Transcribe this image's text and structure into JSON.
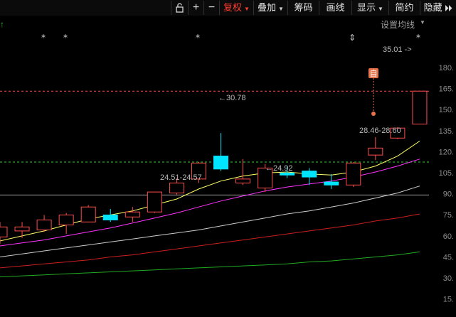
{
  "toolbar": {
    "items": [
      {
        "label": "",
        "icon": "unlock-icon"
      },
      {
        "label": "+",
        "icon": "zoom-in-icon"
      },
      {
        "label": "−",
        "icon": "zoom-out-icon"
      },
      {
        "label": "复权",
        "dropdown": true,
        "active": true
      },
      {
        "label": "叠加",
        "dropdown": true
      },
      {
        "label": "筹码"
      },
      {
        "label": "画线"
      },
      {
        "label": "显示",
        "dropdown": true
      },
      {
        "label": "简约"
      },
      {
        "label": "隐藏"
      }
    ],
    "hide_icon": "double-chevron-right-icon"
  },
  "settings_label": "设置均线",
  "corner_icon": "up-arrow-icon",
  "price_level": "35.01",
  "price_arrow": "->",
  "marker_label": "自",
  "event_markers": [
    "*",
    "*",
    "*",
    "⇕",
    "*"
  ],
  "colors": {
    "up": "#ff4d4d",
    "down": "#00e5ff",
    "ma5": "#ffff66",
    "ma10": "#ff33ff",
    "ma20": "#cccccc",
    "ma60": "#cc1f1f",
    "ma120": "#22aa22",
    "active_tab": "#ff3b30"
  },
  "chart_data": {
    "type": "candlestick",
    "y_axis_labels": [
      "180.",
      "165.",
      "150.",
      "135.",
      "120.",
      "105.",
      "90.",
      "75.",
      "60.",
      "45.",
      "30.",
      "15."
    ],
    "annotations": [
      {
        "text": "←30.78"
      },
      {
        "text": "24.51-24.57"
      },
      {
        "text": "←24.92"
      },
      {
        "text": "28.46-28.60"
      }
    ],
    "candles": [
      {
        "open": 20.4,
        "close": 21.4,
        "high": 21.9,
        "low": 19.7
      },
      {
        "open": 21.0,
        "close": 21.4,
        "high": 21.9,
        "low": 20.3
      },
      {
        "open": 21.1,
        "close": 22.1,
        "high": 22.6,
        "low": 20.9
      },
      {
        "open": 21.6,
        "close": 22.6,
        "high": 22.8,
        "low": 20.7
      },
      {
        "open": 21.9,
        "close": 23.4,
        "high": 23.6,
        "low": 21.9
      },
      {
        "open": 22.6,
        "close": 22.1,
        "high": 23.2,
        "low": 21.9
      },
      {
        "open": 22.4,
        "close": 22.9,
        "high": 23.4,
        "low": 21.9
      },
      {
        "open": 22.9,
        "close": 24.9,
        "high": 24.9,
        "low": 22.8
      },
      {
        "open": 24.8,
        "close": 25.8,
        "high": 26.3,
        "low": 24.6
      },
      {
        "open": 26.2,
        "close": 27.8,
        "high": 27.9,
        "low": 25.8
      },
      {
        "open": 28.5,
        "close": 27.2,
        "high": 30.8,
        "low": 27.0
      },
      {
        "open": 25.8,
        "close": 26.2,
        "high": 28.2,
        "low": 25.6
      },
      {
        "open": 25.3,
        "close": 27.3,
        "high": 27.7,
        "low": 24.9
      },
      {
        "open": 26.8,
        "close": 26.6,
        "high": 27.5,
        "low": 26.3
      },
      {
        "open": 27.0,
        "close": 26.4,
        "high": 27.3,
        "low": 25.6
      },
      {
        "open": 25.9,
        "close": 25.6,
        "high": 26.7,
        "low": 25.2
      },
      {
        "open": 25.6,
        "close": 27.8,
        "high": 27.9,
        "low": 25.4
      },
      {
        "open": 28.6,
        "close": 29.3,
        "high": 30.4,
        "low": 28.1
      },
      {
        "open": 30.3,
        "close": 31.3,
        "high": 31.4,
        "low": 30.2
      },
      {
        "open": 31.7,
        "close": 35.0,
        "high": 35.0,
        "low": 31.7
      }
    ],
    "ma": [
      {
        "values": [
          20.0,
          20.5,
          21.0,
          21.6,
          22.2,
          22.6,
          23.0,
          23.6,
          24.2,
          25.2,
          26.0,
          26.5,
          26.8,
          26.9,
          26.7,
          26.6,
          26.9,
          27.5,
          28.5,
          30.0
        ]
      },
      {
        "values": [
          19.5,
          19.8,
          20.1,
          20.5,
          20.9,
          21.3,
          21.8,
          22.3,
          22.8,
          23.4,
          24.0,
          24.5,
          25.0,
          25.4,
          25.7,
          26.0,
          26.4,
          26.9,
          27.5,
          28.2
        ]
      },
      {
        "values": [
          18.4,
          18.7,
          19.0,
          19.3,
          19.6,
          19.9,
          20.2,
          20.5,
          20.8,
          21.1,
          21.5,
          21.9,
          22.3,
          22.7,
          23.0,
          23.4,
          23.8,
          24.3,
          24.8,
          25.5
        ]
      },
      {
        "values": [
          17.3,
          17.5,
          17.7,
          17.9,
          18.1,
          18.4,
          18.6,
          18.9,
          19.2,
          19.5,
          19.8,
          20.1,
          20.4,
          20.7,
          21.0,
          21.3,
          21.6,
          22.0,
          22.3,
          22.7
        ]
      },
      {
        "values": [
          16.4,
          16.5,
          16.6,
          16.7,
          16.8,
          16.9,
          17.0,
          17.1,
          17.2,
          17.3,
          17.4,
          17.5,
          17.6,
          17.7,
          17.9,
          18.0,
          18.2,
          18.4,
          18.6,
          18.9
        ]
      }
    ],
    "reference_lines": [
      {
        "value": 35.0,
        "color": "#ff4d4d",
        "style": "dashed"
      },
      {
        "value": 27.9,
        "color": "#33cc33",
        "style": "dashed"
      },
      {
        "value": 24.6,
        "color": "#9a9a9a",
        "style": "solid"
      }
    ]
  }
}
